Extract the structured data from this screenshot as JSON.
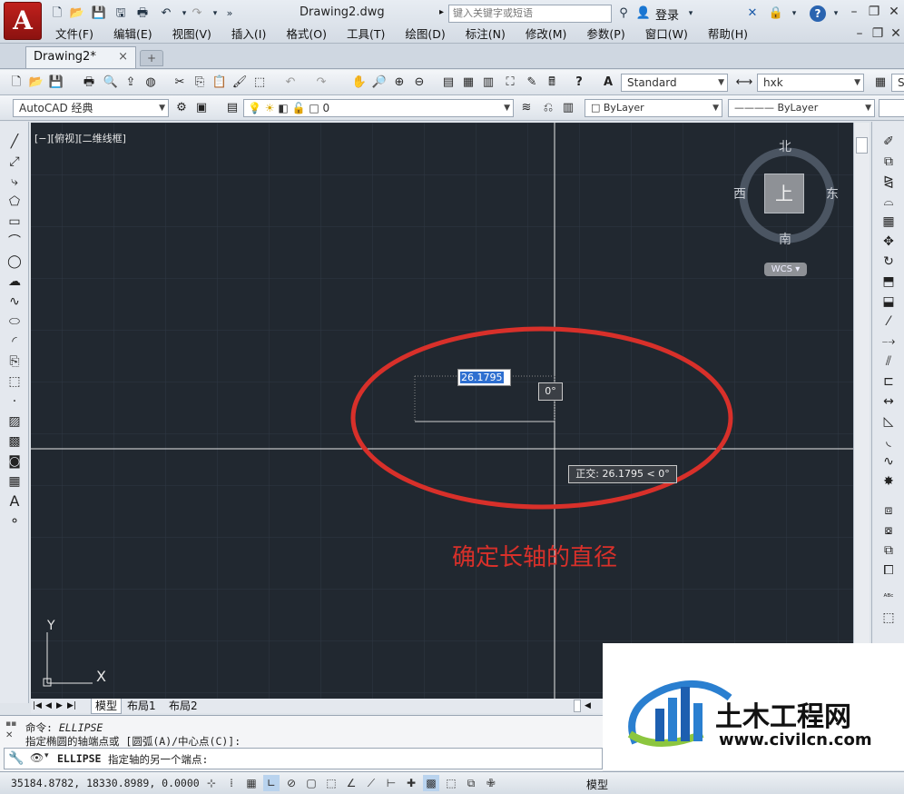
{
  "app": {
    "logo_letter": "A",
    "document_title": "Drawing2.dwg",
    "search_placeholder": "键入关键字或短语",
    "login_label": "登录",
    "help_label": "?"
  },
  "menubar": [
    "文件(F)",
    "编辑(E)",
    "视图(V)",
    "插入(I)",
    "格式(O)",
    "工具(T)",
    "绘图(D)",
    "标注(N)",
    "修改(M)",
    "参数(P)",
    "窗口(W)",
    "帮助(H)"
  ],
  "tabs": {
    "active": "Drawing2*",
    "close": "×"
  },
  "toolbar1": {
    "text_style": "Standard",
    "dim_style": "hxk",
    "extra": "S"
  },
  "toolbar2": {
    "workspace": "AutoCAD 经典",
    "layer": "0",
    "color": "ByLayer",
    "linetype": "ByLayer"
  },
  "viewport": {
    "label": "[−][俯视][二维线框]",
    "viewcube": {
      "north": "北",
      "south": "南",
      "west": "西",
      "east": "东",
      "top": "上",
      "wcs": "WCS"
    },
    "dynamic_input": "26.1795",
    "angle_tip": "0°",
    "polar_tip": "正交: 26.1795 < 0°",
    "annotation": "确定长轴的直径",
    "ucs": {
      "x": "X",
      "y": "Y"
    },
    "annotation_color": "#d8302a"
  },
  "layout_tabs": [
    "模型",
    "布局1",
    "布局2"
  ],
  "command": {
    "line1_prefix": "命令:",
    "line1_cmd": "ELLIPSE",
    "line2": "指定椭圆的轴端点或 [圆弧(A)/中心点(C)]:",
    "current_cmd": "ELLIPSE",
    "current_prompt": "指定轴的另一个端点:"
  },
  "status": {
    "coordinates": "35184.8782, 18330.8989, 0.0000",
    "model_label": "模型"
  },
  "watermark": {
    "brand": "土木工程网",
    "url": "www.civilcn.com"
  }
}
